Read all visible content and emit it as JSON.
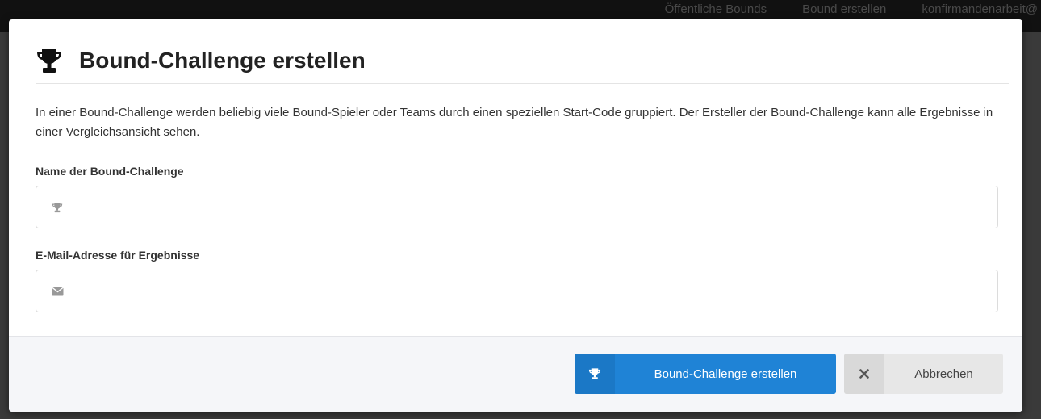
{
  "topnav": {
    "items": [
      "Öffentliche Bounds",
      "Bound erstellen",
      "konfirmandenarbeit@"
    ]
  },
  "modal": {
    "title": "Bound-Challenge erstellen",
    "intro": "In einer Bound-Challenge werden beliebig viele Bound-Spieler oder Teams durch einen speziellen Start-Code gruppiert. Der Ersteller der Bound-Challenge kann alle Ergebnisse in einer Vergleichsansicht sehen.",
    "fields": {
      "name": {
        "label": "Name der Bound-Challenge",
        "value": "",
        "placeholder": "",
        "icon": "trophy-icon"
      },
      "email": {
        "label": "E-Mail-Adresse für Ergebnisse",
        "value": "",
        "placeholder": "",
        "icon": "envelope-icon"
      }
    },
    "footer": {
      "submit_label": "Bound-Challenge erstellen",
      "cancel_label": "Abbrechen"
    }
  },
  "colors": {
    "primary": "#1f83d6",
    "secondary": "#e7e7e7",
    "footer_bg": "#f5f6f9"
  }
}
